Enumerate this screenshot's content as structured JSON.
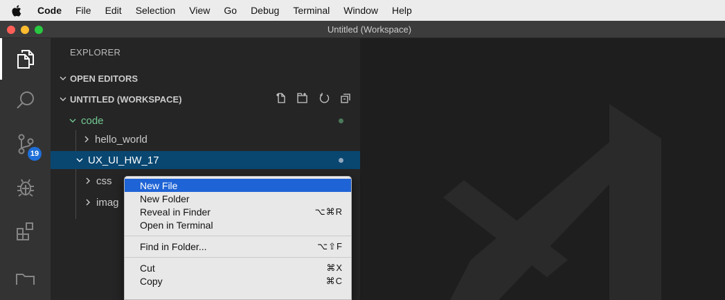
{
  "menubar": {
    "app_name": "Code",
    "items": [
      "File",
      "Edit",
      "Selection",
      "View",
      "Go",
      "Debug",
      "Terminal",
      "Window",
      "Help"
    ]
  },
  "window": {
    "title": "Untitled (Workspace)"
  },
  "activity_bar": {
    "items": [
      {
        "name": "explorer-icon",
        "active": true
      },
      {
        "name": "search-icon"
      },
      {
        "name": "source-control-icon",
        "badge": "19"
      },
      {
        "name": "debug-icon"
      },
      {
        "name": "extensions-icon"
      },
      {
        "name": "folder-icon"
      }
    ]
  },
  "sidebar": {
    "title": "EXPLORER",
    "open_editors": "OPEN EDITORS",
    "workspace": "UNTITLED (WORKSPACE)",
    "workspace_actions": [
      "new-file-icon",
      "new-folder-icon",
      "refresh-icon",
      "collapse-all-icon"
    ],
    "tree": [
      {
        "label": "code",
        "expanded": true
      },
      {
        "label": "hello_world",
        "expanded": false
      },
      {
        "label": "UX_UI_HW_17",
        "expanded": true,
        "selected": true
      },
      {
        "label": "css",
        "expanded": false
      },
      {
        "label": "imag",
        "expanded": false
      }
    ]
  },
  "context_menu": {
    "items": [
      {
        "label": "New File",
        "shortcut": "",
        "highlight": true
      },
      {
        "label": "New Folder",
        "shortcut": ""
      },
      {
        "label": "Reveal in Finder",
        "shortcut": "⌥⌘R"
      },
      {
        "label": "Open in Terminal",
        "shortcut": ""
      },
      {
        "separator": true
      },
      {
        "label": "Find in Folder...",
        "shortcut": "⌥⇧F"
      },
      {
        "separator": true
      },
      {
        "label": "Cut",
        "shortcut": "⌘X"
      },
      {
        "label": "Copy",
        "shortcut": "⌘C"
      }
    ]
  },
  "colors": {
    "accent": "#1f64d6",
    "selection": "#094771",
    "git_modified": "#73c991",
    "badge": "#1f6fd8"
  }
}
